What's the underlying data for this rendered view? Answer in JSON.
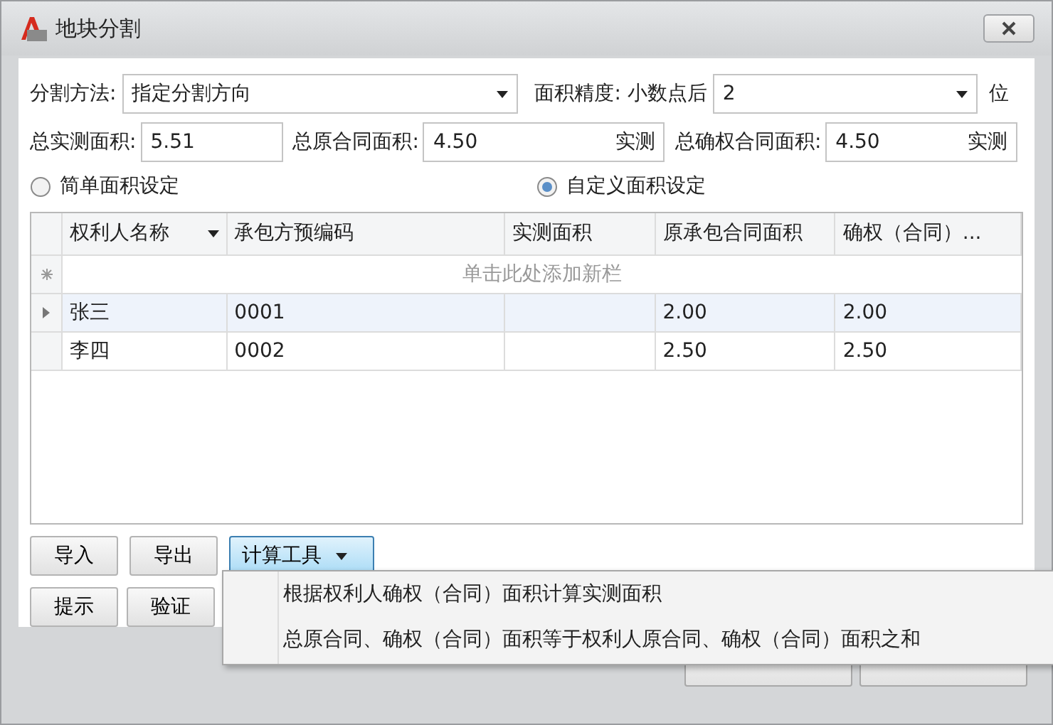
{
  "window": {
    "title": "地块分割"
  },
  "split_method": {
    "label": "分割方法:",
    "value": "指定分割方向"
  },
  "precision": {
    "label": "面积精度: 小数点后",
    "value": "2",
    "unit": "位"
  },
  "totals": [
    {
      "label": "总实测面积:",
      "value": "5.51"
    },
    {
      "label": "总原合同面积:",
      "value": "4.50",
      "button": "实测"
    },
    {
      "label": "总确权合同面积:",
      "value": "4.50",
      "button": "实测"
    }
  ],
  "area_modes": [
    {
      "label": "简单面积设定",
      "selected": false
    },
    {
      "label": "自定义面积设定",
      "selected": true
    }
  ],
  "table": {
    "columns": [
      {
        "label": "权利人名称",
        "sortable": true
      },
      {
        "label": "承包方预编码",
        "sortable": false
      },
      {
        "label": "实测面积",
        "sortable": false
      },
      {
        "label": "原承包合同面积",
        "sortable": false
      },
      {
        "label": "确权（合同）...",
        "sortable": false
      }
    ],
    "new_row_hint": "单击此处添加新栏",
    "rows": [
      {
        "cells": [
          "张三",
          "0001",
          "",
          "2.00",
          "2.00"
        ],
        "current": true
      },
      {
        "cells": [
          "李四",
          "0002",
          "",
          "2.50",
          "2.50"
        ],
        "current": false
      }
    ]
  },
  "buttons_row1": [
    "导入",
    "导出"
  ],
  "buttons_row2": [
    "提示",
    "验证"
  ],
  "tool_menu": {
    "label": "计算工具",
    "expanded": true,
    "items": [
      "根据权利人确权（合同）面积计算实测面积",
      "总原合同、确权（合同）面积等于权利人原合同、确权（合同）面积之和"
    ]
  }
}
